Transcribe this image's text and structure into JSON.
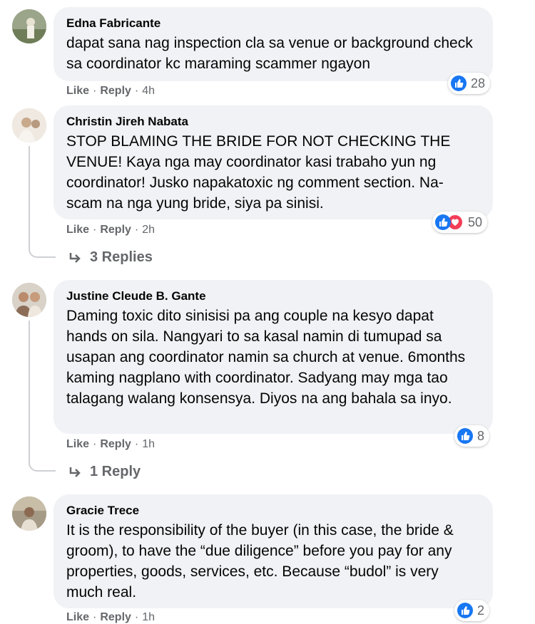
{
  "comments": [
    {
      "author": "Edna Fabricante",
      "text": "dapat sana nag inspection cla sa venue or background check sa coordinator kc maraming scammer ngayon",
      "like_label": "Like",
      "reply_label": "Reply",
      "time": "4h",
      "reaction_count": "28",
      "reactions": [
        "like-icon"
      ]
    },
    {
      "author": "Christin Jireh Nabata",
      "text": "STOP BLAMING THE BRIDE FOR NOT CHECKING THE VENUE! Kaya nga may coordinator kasi trabaho yun ng coordinator! Jusko napakatoxic ng comment section. Na-scam na nga yung bride, siya pa sinisi.",
      "like_label": "Like",
      "reply_label": "Reply",
      "time": "2h",
      "reaction_count": "50",
      "reactions": [
        "like-icon",
        "love-icon"
      ],
      "replies_label": "3 Replies"
    },
    {
      "author": "Justine Cleude B. Gante",
      "text": "Daming toxic dito sinisisi pa ang couple na kesyo dapat hands on sila. Nangyari to sa kasal namin di tumupad sa usapan ang coordinator namin sa church at venue. 6months kaming nagplano with coordinator. Sadyang may mga tao talagang walang konsensya. Diyos na ang bahala sa inyo.",
      "like_label": "Like",
      "reply_label": "Reply",
      "time": "1h",
      "reaction_count": "8",
      "reactions": [
        "like-icon"
      ],
      "replies_label": "1 Reply"
    },
    {
      "author": "Gracie Trece",
      "text": "It is the responsibility of the buyer (in this case, the bride & groom), to have the “due diligence” before you pay for any properties, goods, services, etc. Because “budol” is very much real.",
      "like_label": "Like",
      "reply_label": "Reply",
      "time": "1h",
      "reaction_count": "2",
      "reactions": [
        "like-icon"
      ]
    }
  ],
  "colors": {
    "bubble": "#f0f2f5",
    "like": "#1877f2",
    "love": "#f33e58",
    "meta": "#65676b"
  }
}
